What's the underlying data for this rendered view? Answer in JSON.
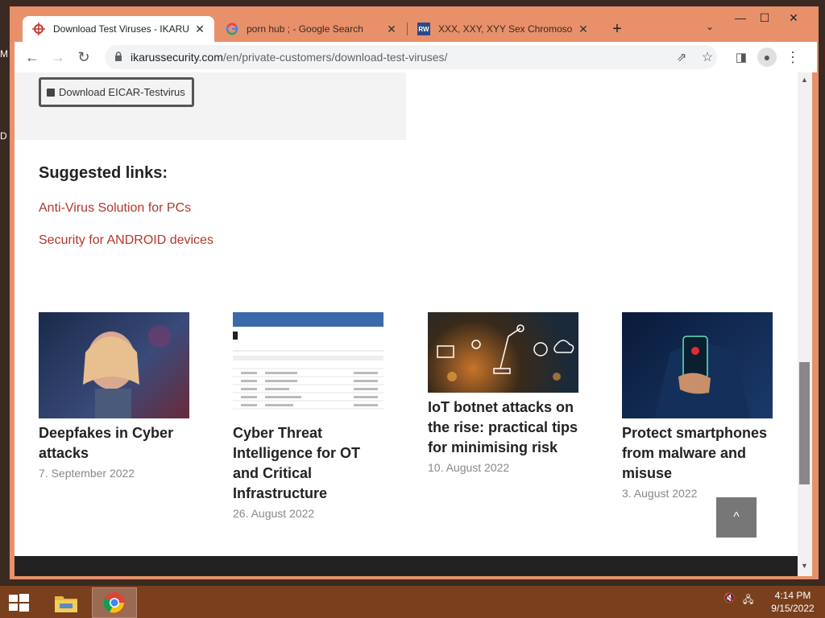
{
  "desktop": {
    "left_chars": [
      "M",
      "D"
    ]
  },
  "browser": {
    "tabs": [
      {
        "title": "Download Test Viruses - IKARUS",
        "favicon": "ikarus-icon",
        "active": true
      },
      {
        "title": "porn hub ; - Google Search",
        "favicon": "google-icon",
        "active": false
      },
      {
        "title": "XXX, XXY, XYY Sex Chromosome",
        "favicon": "rw-icon",
        "favicon_text": "RW",
        "active": false
      }
    ],
    "new_tab": "+",
    "url": {
      "host": "ikarussecurity.com",
      "path": "/en/private-customers/download-test-viruses/"
    }
  },
  "page": {
    "download_button": "Download EICAR-Testvirus",
    "suggested_heading": "Suggested links:",
    "suggested_links": [
      "Anti-Virus Solution for PCs",
      "Security for ANDROID devices"
    ],
    "articles": [
      {
        "title": "Deepfakes in Cyber attacks",
        "date": "7. September 2022"
      },
      {
        "title": "Cyber Threat Intelligence for OT and Critical Infrastructure",
        "date": "26. August 2022"
      },
      {
        "title": "IoT botnet attacks on the rise: practical tips for minimising risk",
        "date": "10. August 2022"
      },
      {
        "title": "Protect smartphones from malware and misuse",
        "date": "3. August 2022"
      }
    ],
    "back_to_top": "^"
  },
  "taskbar": {
    "time": "4:14 PM",
    "date": "9/15/2022"
  },
  "colors": {
    "link": "#b5362a",
    "frame": "#e8906a",
    "taskbar": "#7a3f1c"
  }
}
